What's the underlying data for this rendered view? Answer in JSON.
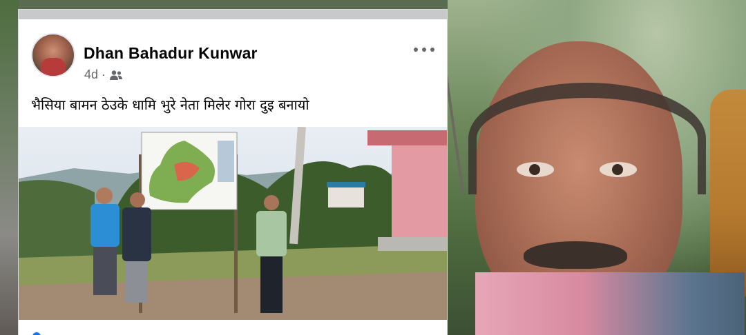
{
  "post": {
    "author_name": "Dhan Bahadur Kunwar",
    "timestamp": "4d",
    "separator": "·",
    "audience_icon": "friends-icon",
    "more_icon": "more-horizontal-icon",
    "text": "भैसिया बामन ठेउके धामि भुरे  नेता मिलेर गोरा दुइ बनायो"
  },
  "colors": {
    "card_bg": "#ffffff",
    "name_text": "#050505",
    "meta_text": "#65676b",
    "accent": "#1877f2"
  }
}
